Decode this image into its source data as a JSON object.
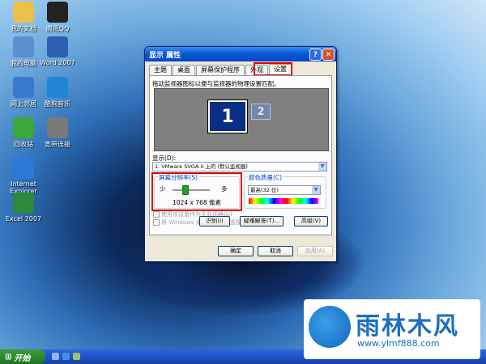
{
  "desktop": {
    "icons": [
      {
        "label": "我的文档",
        "icon": "folder-icon",
        "color": "#e8c04a"
      },
      {
        "label": "腾讯QQ",
        "icon": "qq-penguin-icon",
        "color": "#222222"
      },
      {
        "label": "我的电脑",
        "icon": "computer-icon",
        "color": "#5a8fd0"
      },
      {
        "label": "Word 2007",
        "icon": "word-icon",
        "color": "#2b5fb0"
      },
      {
        "label": "网上邻居",
        "icon": "network-icon",
        "color": "#3a7acc"
      },
      {
        "label": "酷狗音乐",
        "icon": "kugou-icon",
        "color": "#1f86d6"
      },
      {
        "label": "回收站",
        "icon": "recycle-bin-icon",
        "color": "#3aa83a"
      },
      {
        "label": "宽带连接",
        "icon": "broadband-icon",
        "color": "#7a7a7a"
      },
      {
        "label": "Internet Explorer",
        "icon": "ie-icon",
        "color": "#2a7bd8"
      },
      {
        "label": "Excel 2007",
        "icon": "excel-icon",
        "color": "#2c8a3c"
      }
    ]
  },
  "dialog": {
    "title": "显示 属性",
    "help_glyph": "?",
    "close_glyph": "✕",
    "tabs": [
      "主题",
      "桌面",
      "屏幕保护程序",
      "外观",
      "设置"
    ],
    "active_tab": "设置",
    "description": "拖动监视器图标以便与监视器的物理设置匹配。",
    "monitor_primary": "1",
    "monitor_secondary": "2",
    "display_label": "显示(D):",
    "display_value": "1. VMware SVGA II 上的 (默认监视器)",
    "resolution": {
      "title": "屏幕分辨率(S)",
      "less": "少",
      "more": "多",
      "value": "1024 x 768 像素",
      "slider_fraction": 0.3
    },
    "color_quality": {
      "title": "颜色质量(C)",
      "value": "最高(32 位)"
    },
    "checkbox_primary": "使用该设备作为主监视器(U)",
    "checkbox_extend": "将 Windows 桌面扩展到该监视器上(E)",
    "buttons_row": [
      "识别(I)",
      "疑难解答(T)...",
      "高级(V)"
    ],
    "ok": "确定",
    "cancel": "取消",
    "apply": "应用(A)"
  },
  "taskbar": {
    "start_label": "开始"
  },
  "watermark": {
    "title": "雨林木风",
    "url": "www.ylmf888.com"
  },
  "colors": {
    "accent_red": "#e00000",
    "xp_blue": "#0a5bd8",
    "start_green": "#2f8a2f"
  }
}
